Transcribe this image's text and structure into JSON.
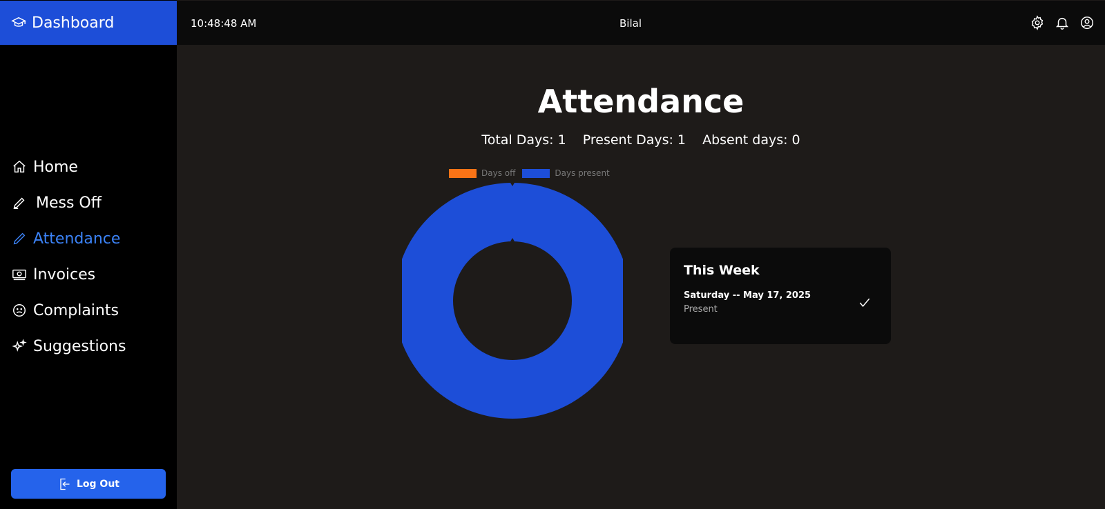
{
  "brand": {
    "label": "Dashboard",
    "icon": "graduation-cap-icon",
    "color": "#1d4ed8"
  },
  "sidebar": {
    "items": [
      {
        "label": "Home",
        "icon": "home-icon",
        "active": false
      },
      {
        "label": "Mess Off",
        "icon": "pen-icon",
        "active": false
      },
      {
        "label": "Attendance",
        "icon": "pencil-icon",
        "active": true
      },
      {
        "label": "Invoices",
        "icon": "cash-icon",
        "active": false
      },
      {
        "label": "Complaints",
        "icon": "sad-face-icon",
        "active": false
      },
      {
        "label": "Suggestions",
        "icon": "sparkles-icon",
        "active": false
      }
    ],
    "logout_label": "Log Out"
  },
  "topbar": {
    "time": "10:48:48 AM",
    "user": "Bilal",
    "icons": [
      "settings-icon",
      "bell-icon",
      "user-circle-icon"
    ]
  },
  "main": {
    "title": "Attendance",
    "stats": {
      "total": "Total Days: 1",
      "present": "Present Days: 1",
      "absent": "Absent days: 0"
    }
  },
  "chart_data": {
    "type": "pie",
    "categories": [
      "Days off",
      "Days present"
    ],
    "values": [
      0,
      1
    ],
    "colors": [
      "#f97316",
      "#1d4ed8"
    ],
    "legend": "top"
  },
  "week": {
    "title": "This Week",
    "entries": [
      {
        "day": "Saturday -- May 17, 2025",
        "status": "Present",
        "icon": "check-icon"
      }
    ]
  },
  "colors": {
    "accent": "#3b82f6",
    "present": "#1d4ed8",
    "off": "#f97316"
  }
}
